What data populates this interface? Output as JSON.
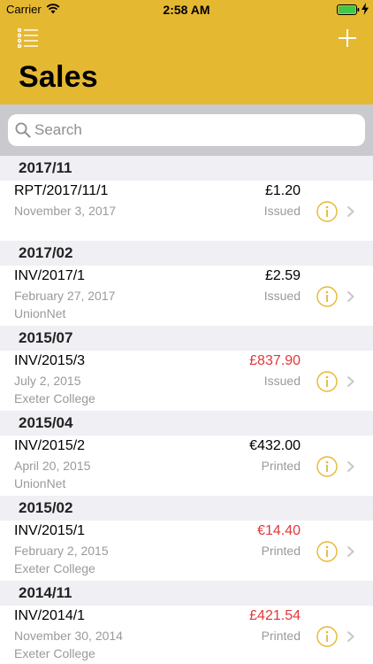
{
  "status_bar": {
    "carrier": "Carrier",
    "time": "2:58 AM"
  },
  "header": {
    "title": "Sales"
  },
  "search": {
    "placeholder": "Search"
  },
  "colors": {
    "header": "#e5b832",
    "info_accent": "#e5b832",
    "negative_amount": "#e0383a"
  },
  "sections": [
    {
      "title": "2017/11",
      "rows": [
        {
          "ref": "RPT/2017/11/1",
          "amount": "£1.20",
          "amount_red": false,
          "date": "November 3, 2017",
          "status": "Issued",
          "customer": ""
        }
      ]
    },
    {
      "title": "2017/02",
      "rows": [
        {
          "ref": "INV/2017/1",
          "amount": "£2.59",
          "amount_red": false,
          "date": "February 27, 2017",
          "status": "Issued",
          "customer": "UnionNet"
        }
      ]
    },
    {
      "title": "2015/07",
      "rows": [
        {
          "ref": "INV/2015/3",
          "amount": "£837.90",
          "amount_red": true,
          "date": "July 2, 2015",
          "status": "Issued",
          "customer": "Exeter College"
        }
      ]
    },
    {
      "title": "2015/04",
      "rows": [
        {
          "ref": "INV/2015/2",
          "amount": "€432.00",
          "amount_red": false,
          "date": "April 20, 2015",
          "status": "Printed",
          "customer": "UnionNet"
        }
      ]
    },
    {
      "title": "2015/02",
      "rows": [
        {
          "ref": "INV/2015/1",
          "amount": "€14.40",
          "amount_red": true,
          "date": "February 2, 2015",
          "status": "Printed",
          "customer": "Exeter College"
        }
      ]
    },
    {
      "title": "2014/11",
      "rows": [
        {
          "ref": "INV/2014/1",
          "amount": "£421.54",
          "amount_red": true,
          "date": "November 30, 2014",
          "status": "Printed",
          "customer": "Exeter College"
        }
      ]
    }
  ]
}
